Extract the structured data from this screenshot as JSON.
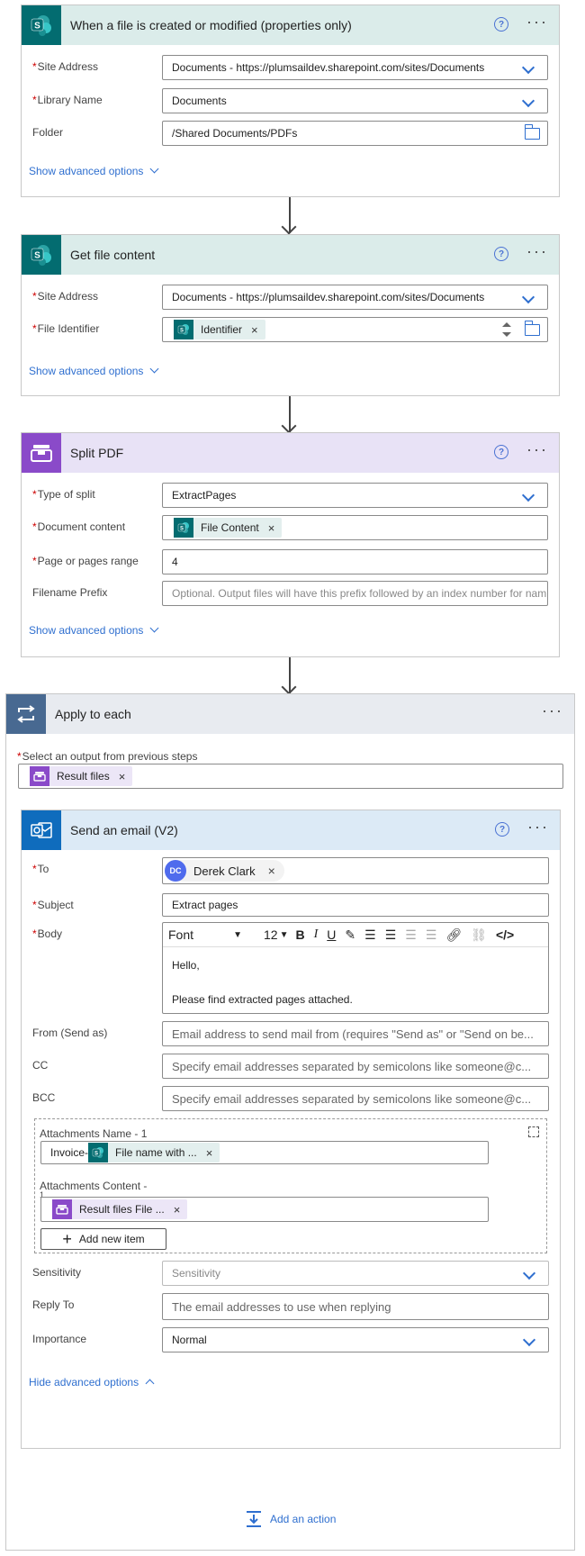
{
  "trigger": {
    "title": "When a file is created or modified (properties only)",
    "help": "?",
    "more": "···",
    "site_label": "Site Address",
    "site_value": "Documents - https://plumsaildev.sharepoint.com/sites/Documents",
    "library_label": "Library Name",
    "library_value": "Documents",
    "folder_label": "Folder",
    "folder_value": "/Shared Documents/PDFs",
    "advanced": "Show advanced options"
  },
  "get_file": {
    "title": "Get file content",
    "help": "?",
    "more": "···",
    "site_label": "Site Address",
    "site_value": "Documents - https://plumsaildev.sharepoint.com/sites/Documents",
    "identifier_label": "File Identifier",
    "identifier_token": "Identifier",
    "advanced": "Show advanced options"
  },
  "split_pdf": {
    "title": "Split PDF",
    "help": "?",
    "more": "···",
    "type_label": "Type of split",
    "type_value": "ExtractPages",
    "content_label": "Document content",
    "content_token": "File Content",
    "pages_label": "Page or pages range",
    "pages_value": "4",
    "prefix_label": "Filename Prefix",
    "prefix_placeholder": "Optional. Output files will have this prefix followed by an index number for nam",
    "advanced": "Show advanced options"
  },
  "apply": {
    "title": "Apply to each",
    "more": "···",
    "select_label": "Select an output from previous steps",
    "select_token": "Result files"
  },
  "email": {
    "title": "Send an email (V2)",
    "help": "?",
    "more": "···",
    "to_label": "To",
    "to_initials": "DC",
    "to_name": "Derek Clark",
    "subject_label": "Subject",
    "subject_value": "Extract pages",
    "body_label": "Body",
    "font_label": "Font",
    "font_size": "12",
    "body_line1": "Hello,",
    "body_line2": "Please find extracted pages attached.",
    "from_label": "From (Send as)",
    "from_placeholder": "Email address to send mail from (requires \"Send as\" or \"Send on be...",
    "cc_label": "CC",
    "cc_placeholder": "Specify email addresses separated by semicolons like someone@c...",
    "bcc_label": "BCC",
    "bcc_placeholder": "Specify email addresses separated by semicolons like someone@c...",
    "att_name_label": "Attachments Name - 1",
    "att_name_prefix": "Invoice-",
    "att_name_token": "File name with ...",
    "att_content_label": "Attachments Content -",
    "att_content_index": "1",
    "att_content_token": "Result files File ...",
    "add_item": "Add new item",
    "sensitivity_label": "Sensitivity",
    "sensitivity_placeholder": "Sensitivity",
    "reply_label": "Reply To",
    "reply_placeholder": "The email addresses to use when replying",
    "importance_label": "Importance",
    "importance_value": "Normal",
    "hide_advanced": "Hide advanced options"
  },
  "add_action": "Add an action",
  "required_mark": "*",
  "token_close": "×"
}
